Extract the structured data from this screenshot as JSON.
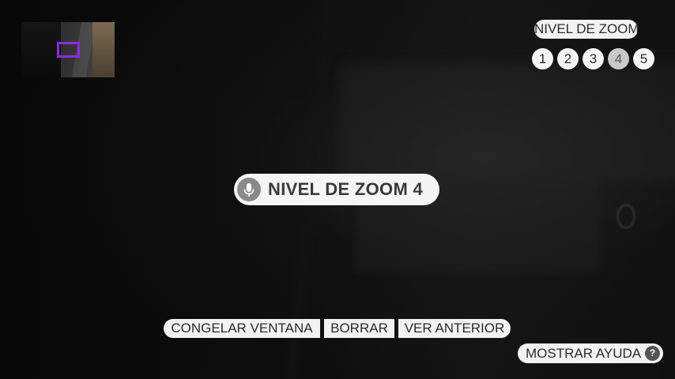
{
  "zoom_panel": {
    "title": "NIVEL DE ZOOM",
    "levels": [
      "1",
      "2",
      "3",
      "4",
      "5"
    ],
    "active_level": "4"
  },
  "status": {
    "text": "NIVEL DE ZOOM 4",
    "icon": "microphone-icon"
  },
  "actions": {
    "freeze": "CONGELAR VENTANA",
    "clear": "BORRAR",
    "previous": "VER ANTERIOR"
  },
  "help": {
    "label": "MOSTRAR AYUDA",
    "icon_glyph": "?"
  },
  "colors": {
    "viewport_indicator": "#8a2be2",
    "pill_background": "#f2f2f2",
    "active_level_background": "#c9c9c9"
  }
}
